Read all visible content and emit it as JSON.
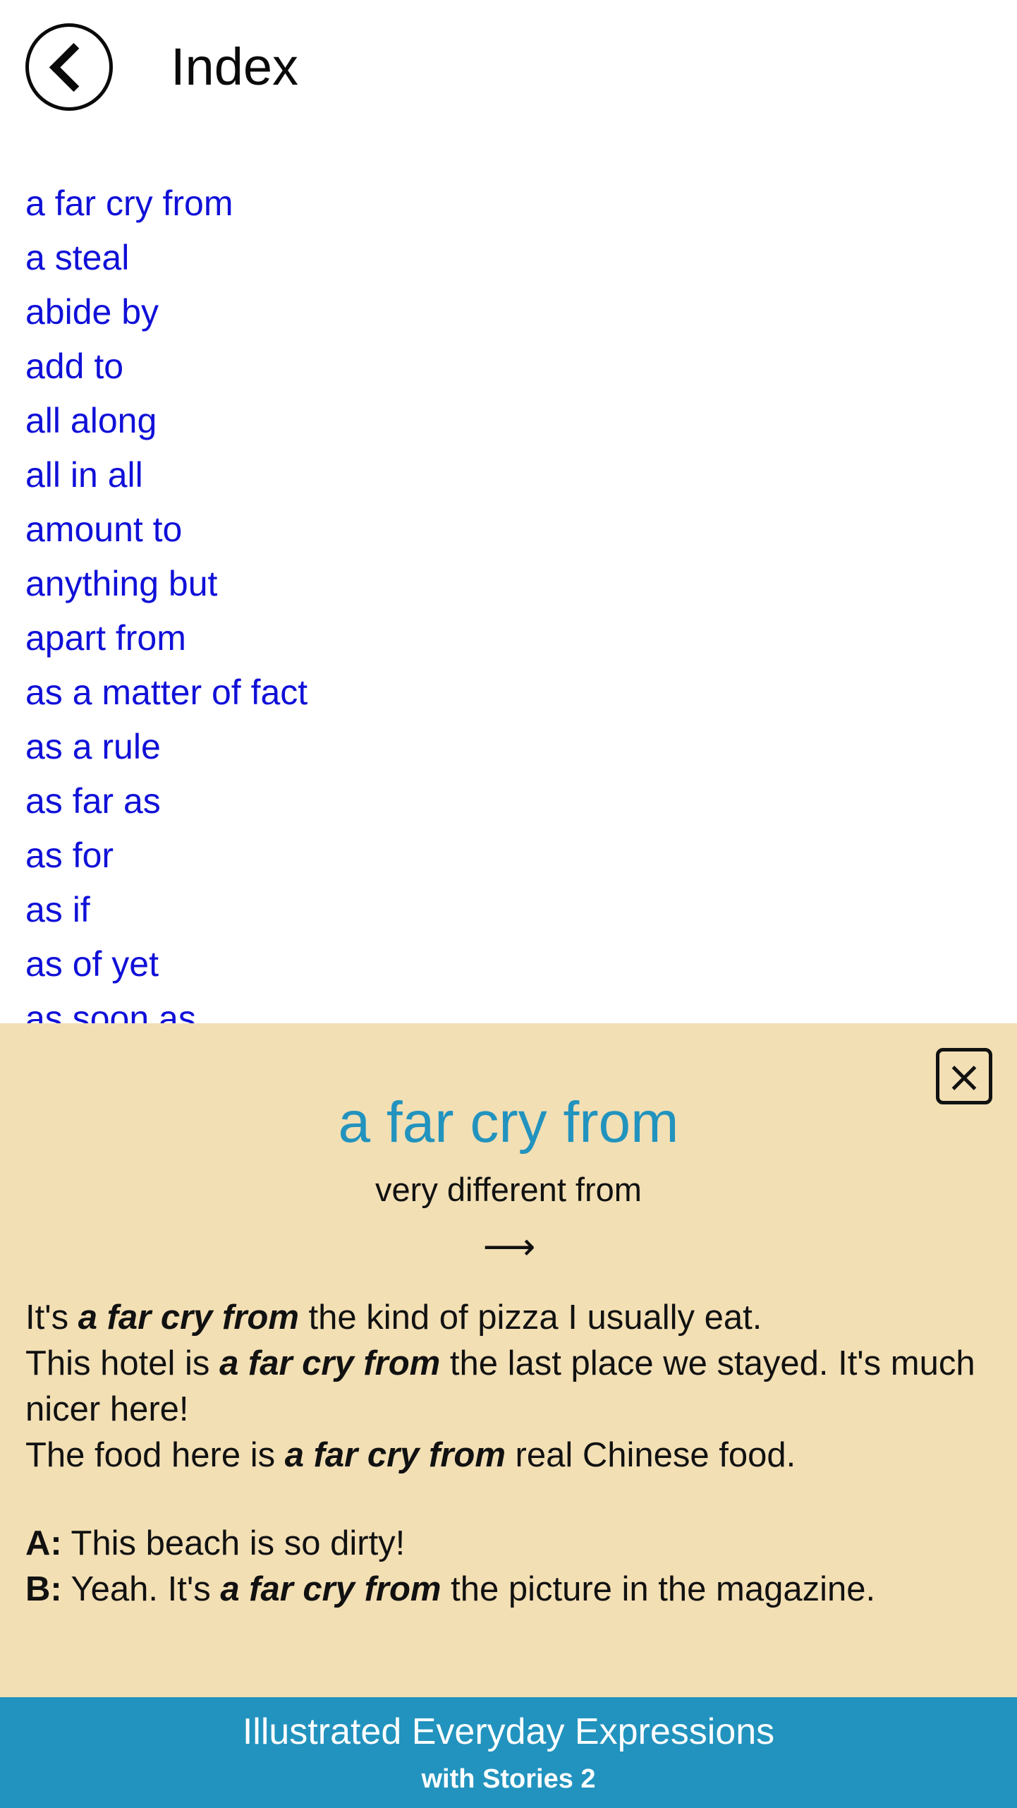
{
  "header": {
    "back_icon": "chevron-left-icon",
    "title": "Index"
  },
  "index": {
    "items": [
      "a far cry from",
      "a steal",
      "abide by",
      "add to",
      "all along",
      "all in all",
      "amount to",
      "anything but",
      "apart from",
      "as a matter of fact",
      "as a rule",
      "as far as",
      "as for",
      "as if",
      "as of yet",
      "as soon as"
    ],
    "link_color": "#1010d8"
  },
  "overlay": {
    "background_color": "#f2dfb4",
    "close_icon": "close-icon",
    "title": "a far cry from",
    "title_color": "#2293be",
    "definition": "very different from",
    "arrow": "⟶",
    "examples": [
      {
        "pre": "It's ",
        "idiom": "a far cry from",
        "post": " the kind of pizza I usually eat."
      },
      {
        "pre": "This hotel is ",
        "idiom": "a far cry from",
        "post": " the last place we stayed. It's much nicer here!"
      },
      {
        "pre": "The food here is ",
        "idiom": "a far cry from",
        "post": " real Chinese food."
      }
    ],
    "dialogue": [
      {
        "speaker": "A:",
        "pre": " This beach is so dirty!",
        "idiom": "",
        "post": ""
      },
      {
        "speaker": "B:",
        "pre": " Yeah. It's ",
        "idiom": "a far cry from",
        "post": " the picture in the magazine."
      }
    ]
  },
  "footer": {
    "title": "Illustrated Everyday Expressions",
    "subtitle": "with Stories 2",
    "background_color": "#2293be"
  }
}
